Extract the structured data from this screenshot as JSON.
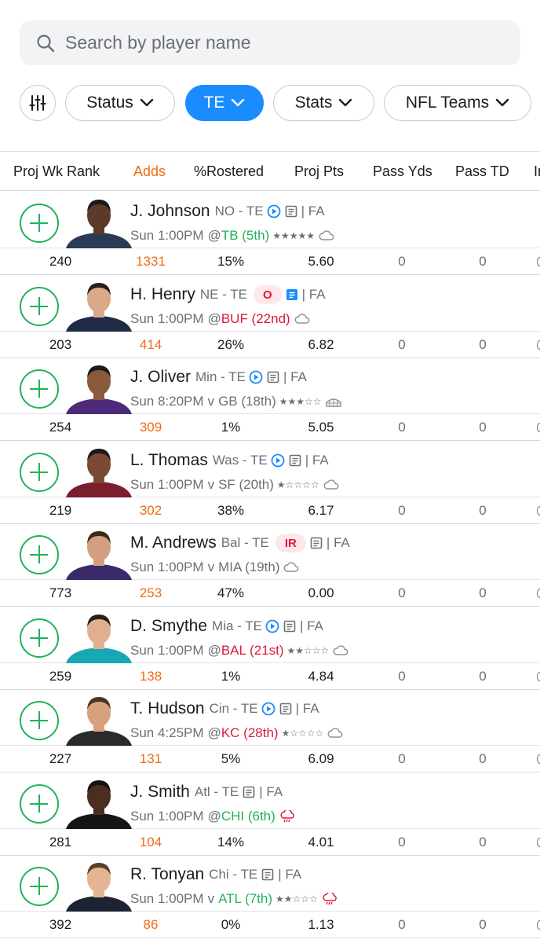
{
  "search": {
    "placeholder": "Search by player name"
  },
  "filters": [
    {
      "label": "Status"
    },
    {
      "label": "TE"
    },
    {
      "label": "Stats"
    },
    {
      "label": "NFL Teams"
    }
  ],
  "columns": [
    "Proj Wk Rank",
    "Adds",
    "%Rostered",
    "Proj Pts",
    "Pass Yds",
    "Pass TD",
    "In"
  ],
  "colors": {
    "accent": "#1a8cff",
    "add": "#20b35a",
    "adds": "#f06a18",
    "good": "#20b35a",
    "bad": "#e0183b"
  },
  "players": [
    {
      "name": "J. Johnson",
      "team_pos": "NO - TE",
      "icons": [
        "play-icon",
        "notes-icon"
      ],
      "badge": "",
      "fa": "| FA",
      "time": "Sun 1:00PM",
      "venue": "@",
      "opp": "TB (5th)",
      "opp_color": "good",
      "stars": "★★★★★",
      "weather": "cloud",
      "proj_rank": "240",
      "adds": "1331",
      "rostered": "15%",
      "proj_pts": "5.60",
      "pass_yds": "0",
      "pass_td": "0"
    },
    {
      "name": "H. Henry",
      "team_pos": "NE - TE",
      "icons": [],
      "badge": "O",
      "fa": "| FA",
      "time": "Sun 1:00PM",
      "venue": "@",
      "opp": "BUF (22nd)",
      "opp_color": "bad",
      "stars": "",
      "weather": "cloud",
      "proj_rank": "203",
      "adds": "414",
      "rostered": "26%",
      "proj_pts": "6.82",
      "pass_yds": "0",
      "pass_td": "0"
    },
    {
      "name": "J. Oliver",
      "team_pos": "Min - TE",
      "icons": [
        "play-icon",
        "notes-icon"
      ],
      "badge": "",
      "fa": "| FA",
      "time": "Sun 8:20PM",
      "venue": "v",
      "opp": "GB (18th)",
      "opp_color": "neutral",
      "stars": "★★★☆☆",
      "weather": "dome",
      "proj_rank": "254",
      "adds": "309",
      "rostered": "1%",
      "proj_pts": "5.05",
      "pass_yds": "0",
      "pass_td": "0"
    },
    {
      "name": "L. Thomas",
      "team_pos": "Was - TE",
      "icons": [
        "play-icon",
        "notes-icon"
      ],
      "badge": "",
      "fa": "| FA",
      "time": "Sun 1:00PM",
      "venue": "v",
      "opp": "SF (20th)",
      "opp_color": "neutral",
      "stars": "★☆☆☆☆",
      "weather": "cloud",
      "proj_rank": "219",
      "adds": "302",
      "rostered": "38%",
      "proj_pts": "6.17",
      "pass_yds": "0",
      "pass_td": "0"
    },
    {
      "name": "M. Andrews",
      "team_pos": "Bal - TE",
      "icons": [
        "notes-icon"
      ],
      "badge": "IR",
      "fa": "| FA",
      "time": "Sun 1:00PM",
      "venue": "v",
      "opp": "MIA (19th)",
      "opp_color": "neutral",
      "stars": "",
      "weather": "cloud",
      "proj_rank": "773",
      "adds": "253",
      "rostered": "47%",
      "proj_pts": "0.00",
      "pass_yds": "0",
      "pass_td": "0"
    },
    {
      "name": "D. Smythe",
      "team_pos": "Mia - TE",
      "icons": [
        "play-icon",
        "notes-icon"
      ],
      "badge": "",
      "fa": "| FA",
      "time": "Sun 1:00PM",
      "venue": "@",
      "opp": "BAL (21st)",
      "opp_color": "bad",
      "stars": "★★☆☆☆",
      "weather": "cloud",
      "proj_rank": "259",
      "adds": "138",
      "rostered": "1%",
      "proj_pts": "4.84",
      "pass_yds": "0",
      "pass_td": "0"
    },
    {
      "name": "T. Hudson",
      "team_pos": "Cin - TE",
      "icons": [
        "play-icon",
        "notes-icon"
      ],
      "badge": "",
      "fa": "| FA",
      "time": "Sun 4:25PM",
      "venue": "@",
      "opp": "KC (28th)",
      "opp_color": "bad",
      "stars": "★☆☆☆☆",
      "weather": "cloud",
      "proj_rank": "227",
      "adds": "131",
      "rostered": "5%",
      "proj_pts": "6.09",
      "pass_yds": "0",
      "pass_td": "0"
    },
    {
      "name": "J. Smith",
      "team_pos": "Atl - TE",
      "icons": [
        "notes-icon"
      ],
      "badge": "",
      "fa": "| FA",
      "time": "Sun 1:00PM",
      "venue": "@",
      "opp": "CHI (6th)",
      "opp_color": "good",
      "stars": "",
      "weather": "rain",
      "proj_rank": "281",
      "adds": "104",
      "rostered": "14%",
      "proj_pts": "4.01",
      "pass_yds": "0",
      "pass_td": "0"
    },
    {
      "name": "R. Tonyan",
      "team_pos": "Chi - TE",
      "icons": [
        "notes-icon"
      ],
      "badge": "",
      "fa": "| FA",
      "time": "Sun 1:00PM",
      "venue": "v",
      "opp": "ATL (7th)",
      "opp_color": "good",
      "stars": "★★☆☆☆",
      "weather": "rain",
      "proj_rank": "392",
      "adds": "86",
      "rostered": "0%",
      "proj_pts": "1.13",
      "pass_yds": "0",
      "pass_td": "0"
    }
  ]
}
